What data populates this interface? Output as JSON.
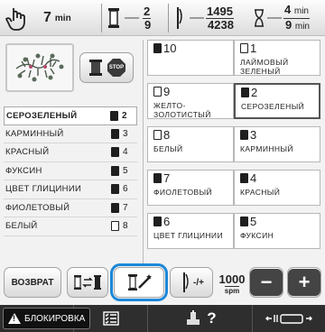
{
  "header": {
    "time_value": "7",
    "time_unit": "min",
    "spool_current": "2",
    "spool_total": "9",
    "stitch_current": "1495",
    "stitch_total": "4238",
    "time_remaining": "4",
    "time_remaining_unit": "min",
    "time_total": "9",
    "time_total_unit": "min"
  },
  "stop_button_text": "STOP",
  "thread_list": [
    {
      "name": "СЕРОЗЕЛЕНЫЙ",
      "num": "2",
      "spool": "full",
      "highlight": true
    },
    {
      "name": "КАРМИННЫЙ",
      "num": "3",
      "spool": "full",
      "highlight": false
    },
    {
      "name": "КРАСНЫЙ",
      "num": "4",
      "spool": "full",
      "highlight": false
    },
    {
      "name": "ФУКСИН",
      "num": "5",
      "spool": "full",
      "highlight": false
    },
    {
      "name": "ЦВЕТ ГЛИЦИНИИ",
      "num": "6",
      "spool": "full",
      "highlight": false
    },
    {
      "name": "ФИОЛЕТОВЫЙ",
      "num": "7",
      "spool": "full",
      "highlight": false
    },
    {
      "name": "БЕЛЫЙ",
      "num": "8",
      "spool": "empty",
      "highlight": false
    }
  ],
  "grid_cells": [
    {
      "num": "10",
      "label": "",
      "spool": "full",
      "sel": false
    },
    {
      "num": "1",
      "label": "ЛАЙМОВЫЙ ЗЕЛЕНЫЙ",
      "spool": "empty",
      "sel": false
    },
    {
      "num": "9",
      "label": "ЖЕЛТО-ЗОЛОТИСТЫЙ",
      "spool": "empty",
      "sel": false
    },
    {
      "num": "2",
      "label": "СЕРОЗЕЛЕНЫЙ",
      "spool": "full",
      "sel": true
    },
    {
      "num": "8",
      "label": "БЕЛЫЙ",
      "spool": "empty",
      "sel": false
    },
    {
      "num": "3",
      "label": "КАРМИННЫЙ",
      "spool": "full",
      "sel": false
    },
    {
      "num": "7",
      "label": "ФИОЛЕТОВЫЙ",
      "spool": "full",
      "sel": false
    },
    {
      "num": "4",
      "label": "КРАСНЫЙ",
      "spool": "full",
      "sel": false
    },
    {
      "num": "6",
      "label": "ЦВЕТ ГЛИЦИНИИ",
      "spool": "full",
      "sel": false
    },
    {
      "num": "5",
      "label": "ФУКСИН",
      "spool": "full",
      "sel": false
    }
  ],
  "bottom": {
    "return_label": "ВОЗВРАТ",
    "needle_label": "-/+",
    "speed_value": "1000",
    "speed_unit": "spm",
    "minus": "−",
    "plus": "+"
  },
  "status": {
    "lock_label": "БЛОКИРОВКА",
    "help": "?"
  },
  "colors": {
    "focus": "#1c88d8",
    "status_bg": "#2e2e2e"
  }
}
